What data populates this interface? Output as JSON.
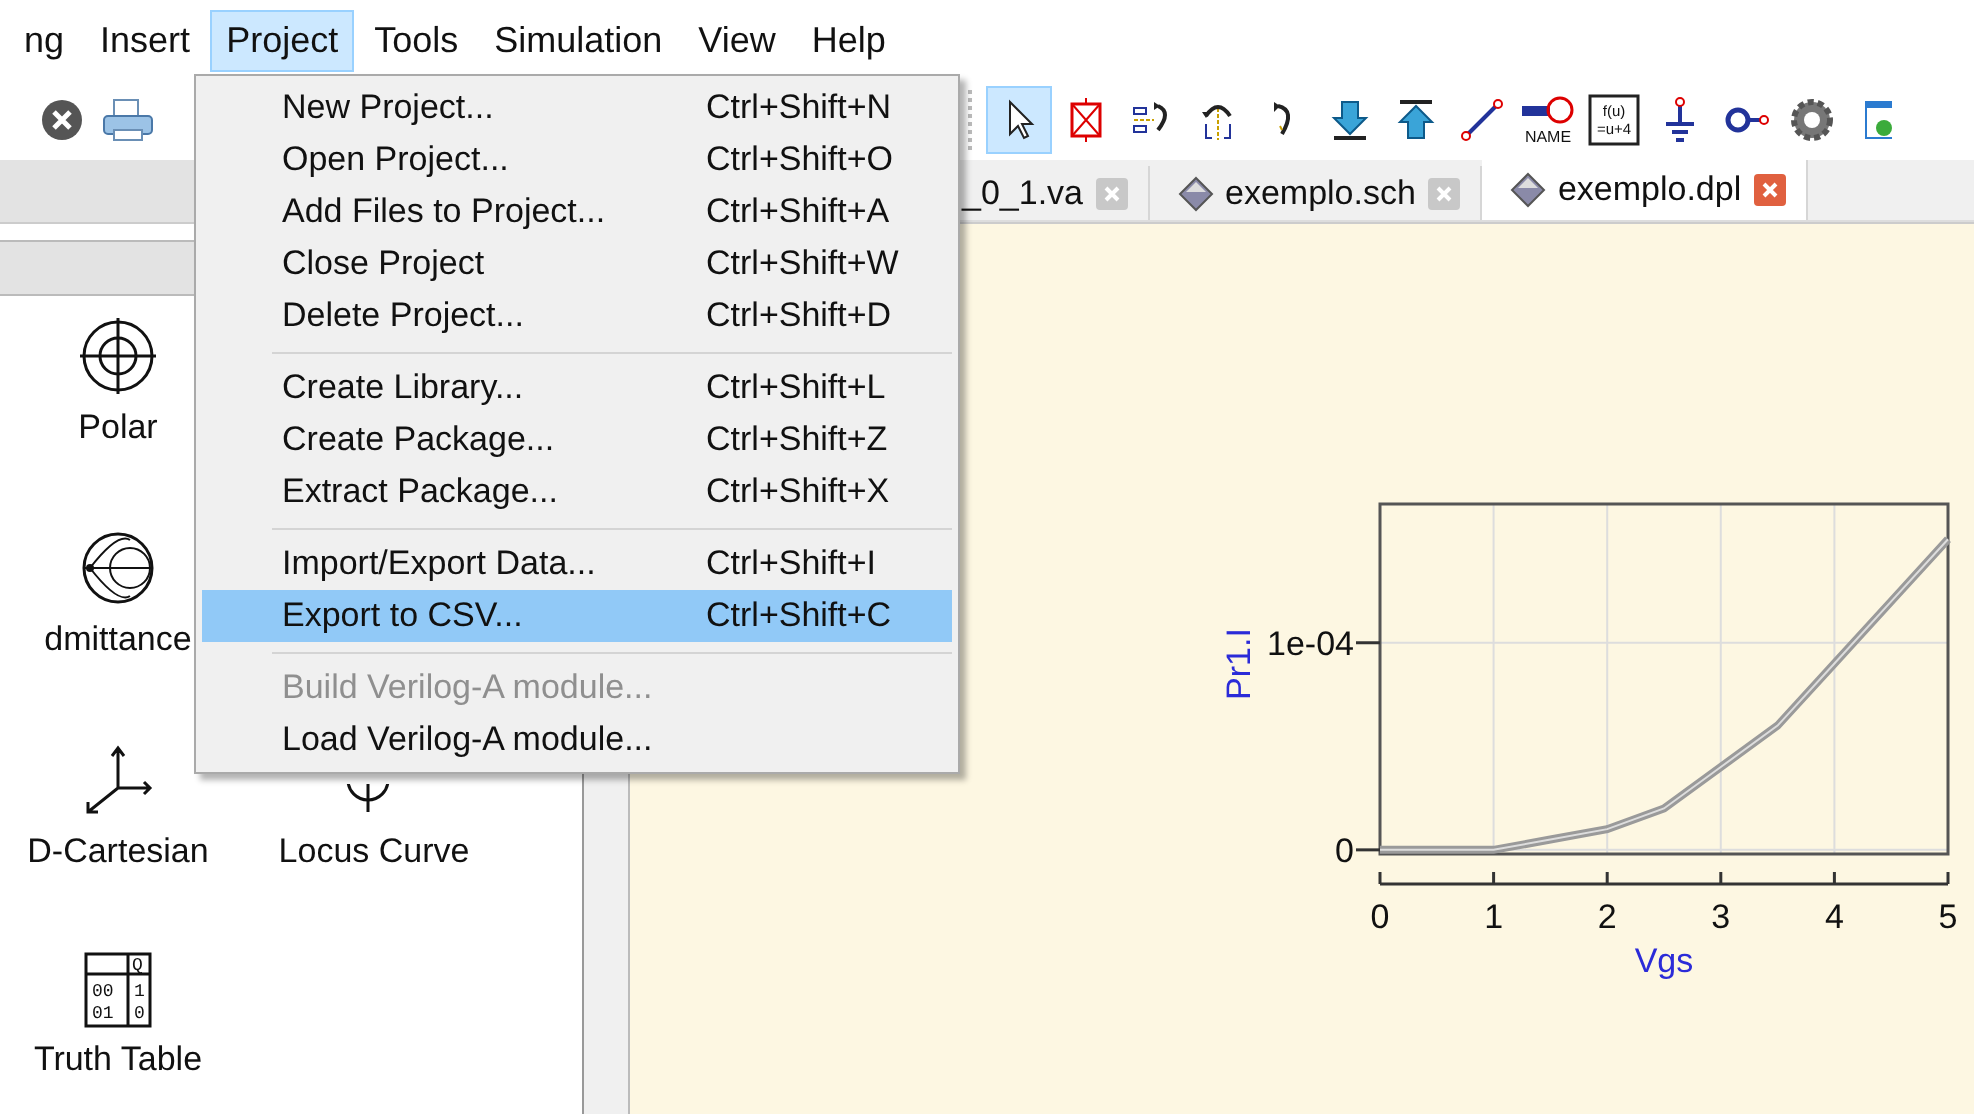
{
  "menu_bar": {
    "items": [
      {
        "label": "ng",
        "selected": false
      },
      {
        "label": "Insert",
        "selected": false
      },
      {
        "label": "Project",
        "selected": true
      },
      {
        "label": "Tools",
        "selected": false
      },
      {
        "label": "Simulation",
        "selected": false
      },
      {
        "label": "View",
        "selected": false
      },
      {
        "label": "Help",
        "selected": false
      }
    ]
  },
  "toolbar": {
    "file_tools": [
      {
        "kind": "close"
      },
      {
        "kind": "print"
      }
    ],
    "edit_tools": [
      {
        "kind": "pointer",
        "selected": true
      },
      {
        "kind": "deactivate",
        "selected": false
      },
      {
        "kind": "mirror",
        "selected": false
      },
      {
        "kind": "mirror_y",
        "selected": false
      },
      {
        "kind": "rotate",
        "selected": false
      },
      {
        "kind": "into",
        "selected": false
      },
      {
        "kind": "pop",
        "selected": false
      },
      {
        "kind": "wire",
        "selected": false
      },
      {
        "kind": "label",
        "selected": false,
        "text": "NAME"
      },
      {
        "kind": "equation",
        "selected": false,
        "lines": [
          "f(u)",
          "=u+4"
        ]
      },
      {
        "kind": "ground",
        "selected": false
      },
      {
        "kind": "port",
        "selected": false
      },
      {
        "kind": "gear",
        "selected": false
      },
      {
        "kind": "window",
        "selected": false
      }
    ]
  },
  "project_menu": {
    "items": [
      {
        "kind": "item",
        "label": "New Project...",
        "shortcut": "Ctrl+Shift+N",
        "selected": false,
        "disabled": false
      },
      {
        "kind": "item",
        "label": "Open Project...",
        "shortcut": "Ctrl+Shift+O",
        "selected": false,
        "disabled": false
      },
      {
        "kind": "item",
        "label": "Add Files to Project...",
        "shortcut": "Ctrl+Shift+A",
        "selected": false,
        "disabled": false
      },
      {
        "kind": "item",
        "label": "Close Project",
        "shortcut": "Ctrl+Shift+W",
        "selected": false,
        "disabled": false
      },
      {
        "kind": "item",
        "label": "Delete Project...",
        "shortcut": "Ctrl+Shift+D",
        "selected": false,
        "disabled": false
      },
      {
        "kind": "separator"
      },
      {
        "kind": "item",
        "label": "Create Library...",
        "shortcut": "Ctrl+Shift+L",
        "selected": false,
        "disabled": false
      },
      {
        "kind": "item",
        "label": "Create Package...",
        "shortcut": "Ctrl+Shift+Z",
        "selected": false,
        "disabled": false
      },
      {
        "kind": "item",
        "label": "Extract Package...",
        "shortcut": "Ctrl+Shift+X",
        "selected": false,
        "disabled": false
      },
      {
        "kind": "separator"
      },
      {
        "kind": "item",
        "label": "Import/Export Data...",
        "shortcut": "Ctrl+Shift+I",
        "selected": false,
        "disabled": false
      },
      {
        "kind": "item",
        "label": "Export to CSV...",
        "shortcut": "Ctrl+Shift+C",
        "selected": true,
        "disabled": false
      },
      {
        "kind": "separator"
      },
      {
        "kind": "item",
        "label": "Build Verilog-A module...",
        "selected": false,
        "disabled": true
      },
      {
        "kind": "item",
        "label": "Load Verilog-A module...",
        "selected": false,
        "disabled": false
      }
    ]
  },
  "diagram_palette": {
    "items": [
      {
        "kind": "polar",
        "label": "Polar"
      },
      {
        "kind": "admittance",
        "label": "dmittance"
      },
      {
        "kind": "cartesian3d",
        "label": "D-Cartesian"
      },
      {
        "kind": "locus",
        "label": "Locus Curve"
      },
      {
        "kind": "truth_table",
        "label": "Truth Table",
        "icon_text": [
          "Q",
          "00",
          "1",
          "01",
          "0"
        ]
      }
    ]
  },
  "tabs": [
    {
      "label": "_0_1.va",
      "selected": false
    },
    {
      "label": "exemplo.sch",
      "selected": false
    },
    {
      "label": "exemplo.dpl",
      "selected": true
    }
  ],
  "diagram": {
    "chart_data": {
      "type": "line",
      "xlabel": "Vgs",
      "ylabel": "Pr1.I",
      "x": [
        0,
        1,
        1.5,
        2,
        2.5,
        3,
        3.5,
        4,
        4.5,
        5
      ],
      "series": [
        {
          "color": "#9a9a9a",
          "values": [
            0,
            0,
            5e-06,
            1e-05,
            2e-05,
            4e-05,
            6e-05,
            9e-05,
            0.00012,
            0.00015
          ]
        }
      ],
      "grid": true,
      "xlim": [
        0,
        5
      ],
      "ylim": [
        -2e-06,
        0.000167
      ],
      "xticks": [
        0,
        1,
        2,
        3,
        4,
        5
      ],
      "yticks": [
        {
          "value": 0,
          "label": "0"
        },
        {
          "value": 0.0001,
          "label": "1e-04"
        }
      ]
    }
  }
}
